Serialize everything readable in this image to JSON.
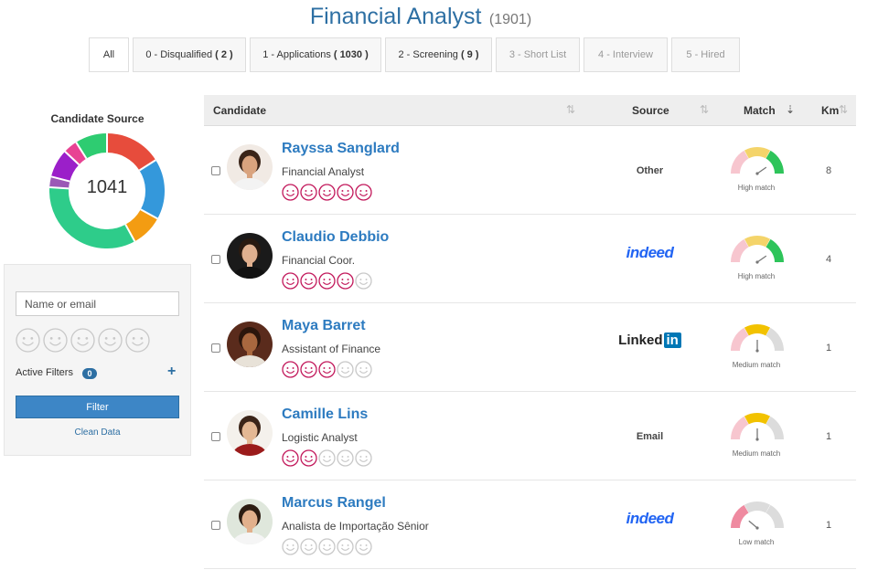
{
  "header": {
    "title": "Financial Analyst",
    "count": "(1901)"
  },
  "tabs": [
    {
      "label": "All",
      "count": ""
    },
    {
      "label": "0 - Disqualified",
      "count": "( 2 )"
    },
    {
      "label": "1 - Applications",
      "count": "( 1030 )"
    },
    {
      "label": "2 - Screening",
      "count": "( 9 )"
    },
    {
      "label": "3 - Short List",
      "count": ""
    },
    {
      "label": "4 - Interview",
      "count": ""
    },
    {
      "label": "5 - Hired",
      "count": ""
    }
  ],
  "sidebar": {
    "chart_title": "Candidate Source",
    "total": "1041",
    "segments": [
      {
        "color": "#e74c3c",
        "fraction": 0.16
      },
      {
        "color": "#3498db",
        "fraction": 0.17
      },
      {
        "color": "#f39c12",
        "fraction": 0.09
      },
      {
        "color": "#2ecc8a",
        "fraction": 0.34
      },
      {
        "color": "#9b59b6",
        "fraction": 0.03
      },
      {
        "color": "#9b1fc9",
        "fraction": 0.08
      },
      {
        "color": "#e84393",
        "fraction": 0.04
      },
      {
        "color": "#2ecc71",
        "fraction": 0.09
      }
    ]
  },
  "filters": {
    "search_placeholder": "Name or email",
    "active_filters_label": "Active Filters",
    "active_filters_count": "0",
    "filter_button": "Filter",
    "clean_link": "Clean Data"
  },
  "table": {
    "headers": {
      "candidate": "Candidate",
      "source": "Source",
      "match": "Match",
      "km": "Km"
    },
    "rows": [
      {
        "name": "Rayssa Sanglard",
        "role": "Financial Analyst",
        "rating": 5,
        "source": "Other",
        "source_type": "text",
        "match_label": "High match",
        "match_level": "high",
        "km": "8"
      },
      {
        "name": "Claudio Debbio",
        "role": "Financial Coor.",
        "rating": 4,
        "source": "indeed",
        "source_type": "indeed",
        "match_label": "High match",
        "match_level": "high",
        "km": "4"
      },
      {
        "name": "Maya Barret",
        "role": "Assistant of Finance",
        "rating": 3,
        "source": "Linked",
        "source_in": "in",
        "source_type": "linkedin",
        "match_label": "Medium match",
        "match_level": "medium",
        "km": "1"
      },
      {
        "name": "Camille Lins",
        "role": "Logistic Analyst",
        "rating": 2,
        "source": "Email",
        "source_type": "text",
        "match_label": "Medium match",
        "match_level": "medium",
        "km": "1"
      },
      {
        "name": "Marcus Rangel",
        "role": "Analista de Importação Sênior",
        "rating": 0,
        "source": "indeed",
        "source_type": "indeed",
        "match_label": "Low match",
        "match_level": "low",
        "km": "1"
      }
    ]
  },
  "colors": {
    "accent": "#2d6fa3",
    "link": "#2d7bc0",
    "rating_active": "#c2185b",
    "rating_inactive": "#c8c8c8"
  }
}
